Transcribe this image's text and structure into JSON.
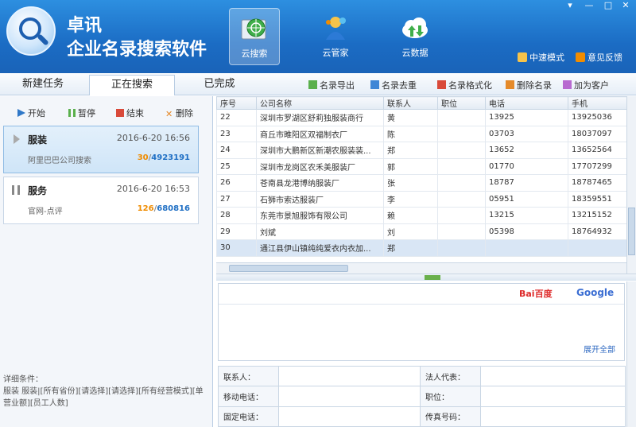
{
  "app": {
    "title_line1": "卓讯",
    "title_line2": "企业名录搜索软件"
  },
  "nav": [
    {
      "label": "云搜索",
      "icon": "cloud-search-icon",
      "active": true
    },
    {
      "label": "云管家",
      "icon": "cloud-butler-icon",
      "active": false
    },
    {
      "label": "云数据",
      "icon": "cloud-data-icon",
      "active": false
    }
  ],
  "header_links": {
    "member_center": "中速模式",
    "feedback": "意见反馈"
  },
  "tabs": [
    "新建任务",
    "正在搜索",
    "已完成"
  ],
  "toolbar": [
    "名录导出",
    "名录去重",
    "名录格式化",
    "删除名录",
    "加为客户"
  ],
  "left_actions": [
    "开始",
    "暂停",
    "结束",
    "删除"
  ],
  "tasks": [
    {
      "name": "服装",
      "time": "2016-6-20 16:56",
      "desc": "阿里巴巴公司搜索",
      "progress_done": "30",
      "progress_total": "4923191"
    },
    {
      "name": "服务",
      "time": "2016-6-20 16:53",
      "desc": "官网-点评",
      "progress_done": "126",
      "progress_total": "680816"
    }
  ],
  "conditions": {
    "label": "详细条件：",
    "text": "服装 服装|[所有省份][请选择][请选择][所有经营模式][单营业额][员工人数]"
  },
  "table": {
    "headers": [
      "序号",
      "公司名称",
      "联系人",
      "职位",
      "电话",
      "手机"
    ],
    "rows": [
      [
        "22",
        "深圳市罗湖区舒莉独服装商行",
        "黄",
        "",
        "13925",
        "13925036"
      ],
      [
        "23",
        "商丘市睢阳区双福制衣厂",
        "陈",
        "",
        "03703",
        "18037097"
      ],
      [
        "24",
        "深圳市大鹏新区新潮农服装装...",
        "郑",
        "",
        "13652",
        "13652564"
      ],
      [
        "25",
        "深圳市龙岗区农禾美服装厂",
        "郭",
        "",
        "01770",
        "17707299"
      ],
      [
        "26",
        "苍南县龙港博纳服装厂",
        "张",
        "",
        "18787",
        "18787465"
      ],
      [
        "27",
        "石狮市索达服装厂",
        "李",
        "",
        "05951",
        "18359551"
      ],
      [
        "28",
        "东莞市景旭服饰有限公司",
        "赖",
        "",
        "13215",
        "13215152"
      ],
      [
        "29",
        "刘斌",
        "刘",
        "",
        "05398",
        "18764932"
      ],
      [
        "30",
        "通江县伊山镇纯纯爱衣内衣加...",
        "郑",
        "",
        "",
        ""
      ]
    ]
  },
  "search_engines": {
    "baidu": "Bai百度",
    "google": "Google"
  },
  "expand_all": "展开全部",
  "detail": [
    [
      "联系人：",
      "",
      "法人代表：",
      ""
    ],
    [
      "移动电话：",
      "",
      "职位：",
      ""
    ],
    [
      "固定电话：",
      "",
      "传真号码：",
      ""
    ]
  ],
  "colors": {
    "header_blue": "#1b6cc4",
    "progress_done": "#f08c00",
    "progress_total": "#1f6fc4"
  }
}
